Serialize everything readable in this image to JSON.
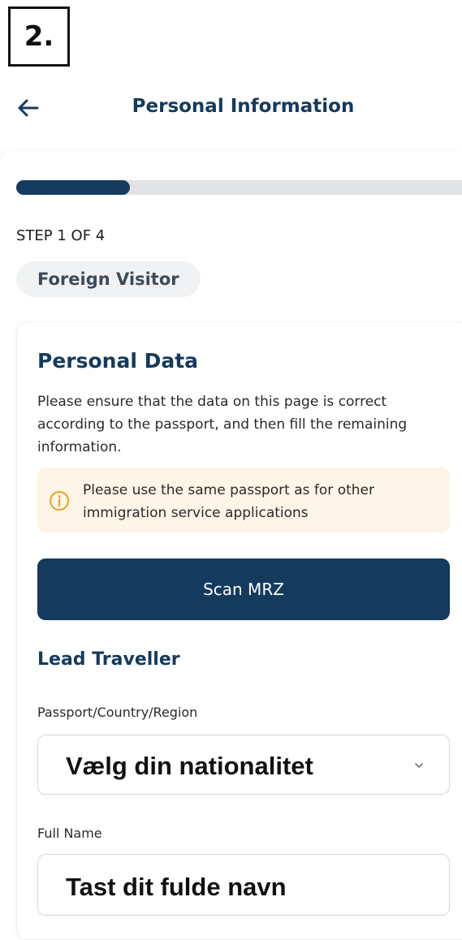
{
  "step_badge": "2.",
  "header": {
    "title": "Personal Information",
    "back_icon": "arrow-left-icon"
  },
  "progress": {
    "current_step": 1,
    "total_steps": 4,
    "fraction": 0.25,
    "label": "STEP 1 OF 4"
  },
  "chip": {
    "label": "Foreign Visitor"
  },
  "card": {
    "title": "Personal Data",
    "description": "Please ensure that the data on this page is correct according to the passport, and then fill the remaining information.",
    "notice": {
      "icon": "info-icon",
      "text": "Please use the same passport as for other immigration service applications"
    },
    "scan_button_label": "Scan MRZ"
  },
  "lead_traveller": {
    "title": "Lead Traveller",
    "passport_field": {
      "label": "Passport/Country/Region",
      "value": "Vælg din nationalitet",
      "icon": "chevron-down-icon"
    },
    "full_name_field": {
      "label": "Full Name",
      "value": "Tast dit fulde navn"
    }
  },
  "colors": {
    "primary": "#143a5e",
    "track": "#e2e3e5",
    "notice_bg": "#fdf5e7",
    "notice_icon": "#e8a21a",
    "chip_bg": "#f1f2f4"
  }
}
